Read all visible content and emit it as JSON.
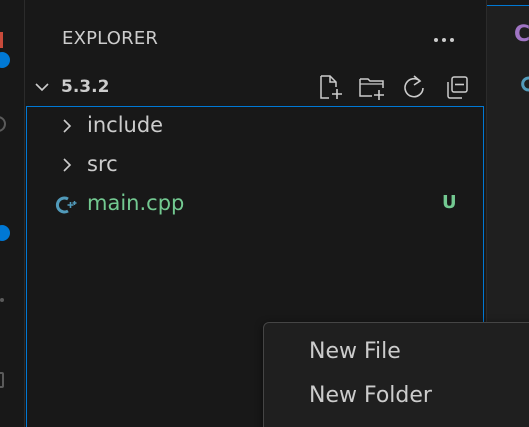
{
  "sidebar": {
    "title": "EXPLORER",
    "more_actions_icon": "ellipsis-icon"
  },
  "section": {
    "title": "5.3.2",
    "actions": [
      {
        "name": "new-file-icon"
      },
      {
        "name": "new-folder-icon"
      },
      {
        "name": "refresh-icon"
      },
      {
        "name": "collapse-all-icon"
      }
    ]
  },
  "tree": [
    {
      "label": "include",
      "type": "folder"
    },
    {
      "label": "src",
      "type": "folder"
    },
    {
      "label": "main.cpp",
      "type": "file",
      "icon": "cpp-file-icon",
      "git_status": "U"
    }
  ],
  "editor": {
    "tab_glyph": "C"
  },
  "context_menu": {
    "items": [
      {
        "label": "New File"
      },
      {
        "label": "New Folder"
      }
    ]
  },
  "colors": {
    "background": "#181818",
    "focus_border": "#0078d4",
    "untracked": "#73c991",
    "cpp_icon": "#519aba",
    "tab_glyph": "#a074c4",
    "text": "#cccccc"
  }
}
